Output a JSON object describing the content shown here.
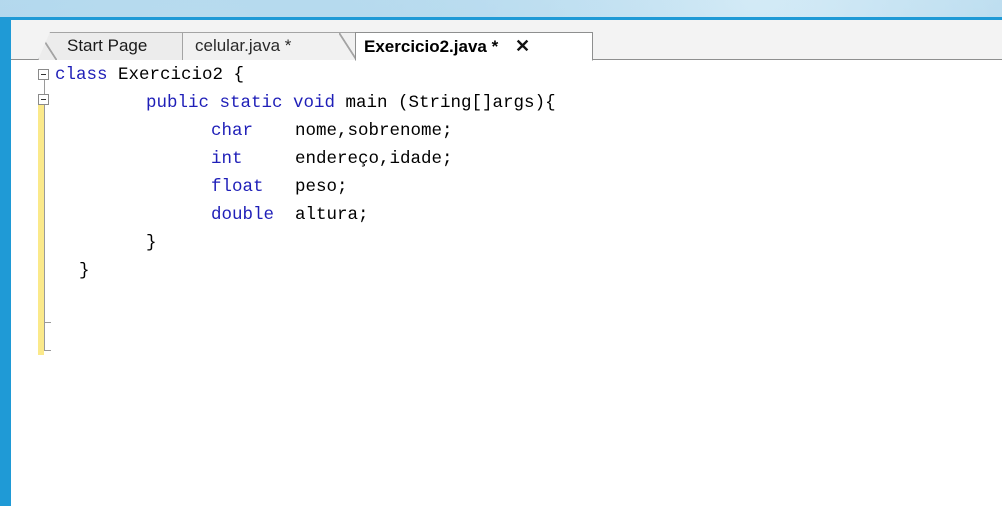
{
  "tabs": [
    {
      "label": "Start Page",
      "active": false
    },
    {
      "label": "celular.java *",
      "active": false
    },
    {
      "label": "Exercicio2.java *",
      "active": true,
      "close": "✕"
    }
  ],
  "editor": {
    "lines": [
      {
        "kw": "class",
        "rest": " Exercicio2 {"
      },
      {
        "kw": "public static void",
        "rest": " main (String[]args){"
      },
      {
        "kw": "char",
        "rest": "    nome,sobrenome;"
      },
      {
        "kw": "int",
        "rest": "     endereço,idade;"
      },
      {
        "kw": "float",
        "rest": "   peso;"
      },
      {
        "kw": "double",
        "rest": "  altura;"
      },
      {
        "kw": "",
        "rest": "}"
      },
      {
        "kw": "",
        "rest": "}"
      }
    ]
  },
  "colors": {
    "keyword": "#1f1fb8",
    "window_border": "#1f9ad6",
    "change_bar": "#fbe98a"
  },
  "icons": {
    "fold_toggle": "fold-minus-icon",
    "tab_close": "close-icon"
  }
}
